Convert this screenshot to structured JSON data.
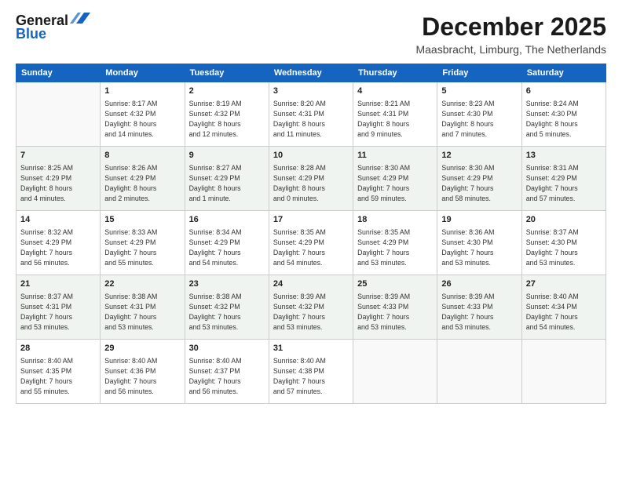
{
  "header": {
    "logo": {
      "line1": "General",
      "line2": "Blue"
    },
    "title": "December 2025",
    "subtitle": "Maasbracht, Limburg, The Netherlands"
  },
  "days_of_week": [
    "Sunday",
    "Monday",
    "Tuesday",
    "Wednesday",
    "Thursday",
    "Friday",
    "Saturday"
  ],
  "weeks": [
    [
      {
        "day": "",
        "info": ""
      },
      {
        "day": "1",
        "info": "Sunrise: 8:17 AM\nSunset: 4:32 PM\nDaylight: 8 hours\nand 14 minutes."
      },
      {
        "day": "2",
        "info": "Sunrise: 8:19 AM\nSunset: 4:32 PM\nDaylight: 8 hours\nand 12 minutes."
      },
      {
        "day": "3",
        "info": "Sunrise: 8:20 AM\nSunset: 4:31 PM\nDaylight: 8 hours\nand 11 minutes."
      },
      {
        "day": "4",
        "info": "Sunrise: 8:21 AM\nSunset: 4:31 PM\nDaylight: 8 hours\nand 9 minutes."
      },
      {
        "day": "5",
        "info": "Sunrise: 8:23 AM\nSunset: 4:30 PM\nDaylight: 8 hours\nand 7 minutes."
      },
      {
        "day": "6",
        "info": "Sunrise: 8:24 AM\nSunset: 4:30 PM\nDaylight: 8 hours\nand 5 minutes."
      }
    ],
    [
      {
        "day": "7",
        "info": "Sunrise: 8:25 AM\nSunset: 4:29 PM\nDaylight: 8 hours\nand 4 minutes."
      },
      {
        "day": "8",
        "info": "Sunrise: 8:26 AM\nSunset: 4:29 PM\nDaylight: 8 hours\nand 2 minutes."
      },
      {
        "day": "9",
        "info": "Sunrise: 8:27 AM\nSunset: 4:29 PM\nDaylight: 8 hours\nand 1 minute."
      },
      {
        "day": "10",
        "info": "Sunrise: 8:28 AM\nSunset: 4:29 PM\nDaylight: 8 hours\nand 0 minutes."
      },
      {
        "day": "11",
        "info": "Sunrise: 8:30 AM\nSunset: 4:29 PM\nDaylight: 7 hours\nand 59 minutes."
      },
      {
        "day": "12",
        "info": "Sunrise: 8:30 AM\nSunset: 4:29 PM\nDaylight: 7 hours\nand 58 minutes."
      },
      {
        "day": "13",
        "info": "Sunrise: 8:31 AM\nSunset: 4:29 PM\nDaylight: 7 hours\nand 57 minutes."
      }
    ],
    [
      {
        "day": "14",
        "info": "Sunrise: 8:32 AM\nSunset: 4:29 PM\nDaylight: 7 hours\nand 56 minutes."
      },
      {
        "day": "15",
        "info": "Sunrise: 8:33 AM\nSunset: 4:29 PM\nDaylight: 7 hours\nand 55 minutes."
      },
      {
        "day": "16",
        "info": "Sunrise: 8:34 AM\nSunset: 4:29 PM\nDaylight: 7 hours\nand 54 minutes."
      },
      {
        "day": "17",
        "info": "Sunrise: 8:35 AM\nSunset: 4:29 PM\nDaylight: 7 hours\nand 54 minutes."
      },
      {
        "day": "18",
        "info": "Sunrise: 8:35 AM\nSunset: 4:29 PM\nDaylight: 7 hours\nand 53 minutes."
      },
      {
        "day": "19",
        "info": "Sunrise: 8:36 AM\nSunset: 4:30 PM\nDaylight: 7 hours\nand 53 minutes."
      },
      {
        "day": "20",
        "info": "Sunrise: 8:37 AM\nSunset: 4:30 PM\nDaylight: 7 hours\nand 53 minutes."
      }
    ],
    [
      {
        "day": "21",
        "info": "Sunrise: 8:37 AM\nSunset: 4:31 PM\nDaylight: 7 hours\nand 53 minutes."
      },
      {
        "day": "22",
        "info": "Sunrise: 8:38 AM\nSunset: 4:31 PM\nDaylight: 7 hours\nand 53 minutes."
      },
      {
        "day": "23",
        "info": "Sunrise: 8:38 AM\nSunset: 4:32 PM\nDaylight: 7 hours\nand 53 minutes."
      },
      {
        "day": "24",
        "info": "Sunrise: 8:39 AM\nSunset: 4:32 PM\nDaylight: 7 hours\nand 53 minutes."
      },
      {
        "day": "25",
        "info": "Sunrise: 8:39 AM\nSunset: 4:33 PM\nDaylight: 7 hours\nand 53 minutes."
      },
      {
        "day": "26",
        "info": "Sunrise: 8:39 AM\nSunset: 4:33 PM\nDaylight: 7 hours\nand 53 minutes."
      },
      {
        "day": "27",
        "info": "Sunrise: 8:40 AM\nSunset: 4:34 PM\nDaylight: 7 hours\nand 54 minutes."
      }
    ],
    [
      {
        "day": "28",
        "info": "Sunrise: 8:40 AM\nSunset: 4:35 PM\nDaylight: 7 hours\nand 55 minutes."
      },
      {
        "day": "29",
        "info": "Sunrise: 8:40 AM\nSunset: 4:36 PM\nDaylight: 7 hours\nand 56 minutes."
      },
      {
        "day": "30",
        "info": "Sunrise: 8:40 AM\nSunset: 4:37 PM\nDaylight: 7 hours\nand 56 minutes."
      },
      {
        "day": "31",
        "info": "Sunrise: 8:40 AM\nSunset: 4:38 PM\nDaylight: 7 hours\nand 57 minutes."
      },
      {
        "day": "",
        "info": ""
      },
      {
        "day": "",
        "info": ""
      },
      {
        "day": "",
        "info": ""
      }
    ]
  ]
}
